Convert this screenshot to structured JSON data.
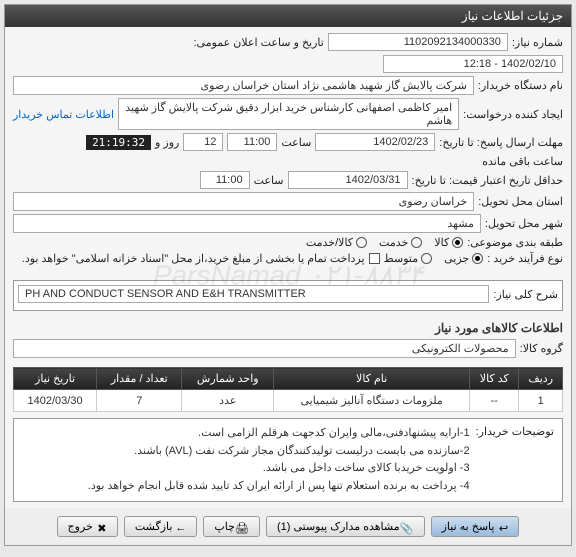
{
  "panel_title": "جزئیات اطلاعات نیاز",
  "header": {
    "req_no_label": "شماره نیاز:",
    "req_no": "1102092134000330",
    "ann_date_label": "تاریخ و ساعت اعلان عمومی:",
    "ann_date": "1402/02/10 - 12:18",
    "buyer_label": "نام دستگاه خریدار:",
    "buyer": "شرکت پالایش گاز شهید هاشمی نژاد   استان خراسان رضوی",
    "creator_label": "ایجاد کننده درخواست:",
    "creator": "امیر کاظمی اصفهانی کارشناس خرید ابزار دقیق شرکت پالایش گاز شهید هاشم",
    "contact_link": "اطلاعات تماس خریدار",
    "deadline_label": "مهلت ارسال پاسخ: تا تاریخ:",
    "deadline_date": "1402/02/23",
    "saat": "ساعت",
    "deadline_hr": "11:00",
    "rooz_va": "روز و",
    "deadline_days": "12",
    "countdown": "21:19:32",
    "remain_label": "ساعت باقی مانده",
    "price_valid_label": "حداقل تاریخ اعتبار قیمت: تا تاریخ:",
    "price_valid_date": "1402/03/31",
    "price_valid_hr": "11:00",
    "province_label": "استان محل تحویل:",
    "province": "خراسان رضوی",
    "city_label": "شهر محل تحویل:",
    "city": "مشهد",
    "class_label": "طبقه بندی موضوعی:",
    "class_goods": "کالا",
    "class_service": "خدمت",
    "class_both": "کالا/خدمت",
    "buy_type_label": "نوع فرآیند خرید :",
    "buy_type_partial": "جزیی",
    "buy_type_medium": "متوسط",
    "pay_note": "پرداخت تمام یا بخشی از مبلغ خرید،از محل \"اسناد خزانه اسلامی\" خواهد بود."
  },
  "need": {
    "title_label": "شرح کلی نیاز:",
    "title": "PH AND CONDUCT SENSOR AND E&H TRANSMITTER"
  },
  "goods": {
    "section": "اطلاعات کالاهای مورد نیاز",
    "group_label": "گروه کالا:",
    "group": "محصولات الکترونیکی",
    "cols": {
      "row": "ردیف",
      "code": "کد کالا",
      "name": "نام کالا",
      "unit": "واحد شمارش",
      "qty": "تعداد / مقدار",
      "date": "تاریخ نیاز"
    },
    "rows": [
      {
        "row": "1",
        "code": "--",
        "name": "ملزومات دستگاه آنالیز شیمیایی",
        "unit": "عدد",
        "qty": "7",
        "date": "1402/03/30"
      }
    ]
  },
  "buyer_desc": {
    "label": "توضیحات خریدار:",
    "text": "1-ارایه پیشنهادفنی،مالی وایران کدجهت هرقلم الزامی است.\n2-سازنده می بایست درلیست تولیدکنندگان مجاز شرکت نفت (AVL)  باشند.\n3- اولویت خریدبا کالای ساخت داخل می باشد.\n4- پرداخت به برنده استعلام تنها پس از ارائه ایران کد تایید شده قابل انجام خواهد بود."
  },
  "buttons": {
    "respond": "پاسخ به نیاز",
    "attachments": "مشاهده مدارک پیوستی (1)",
    "print": "چاپ",
    "back": "بازگشت",
    "exit": "خروج"
  },
  "watermark": "ParsNamad\n۰۲۱-۸۸۳۴"
}
